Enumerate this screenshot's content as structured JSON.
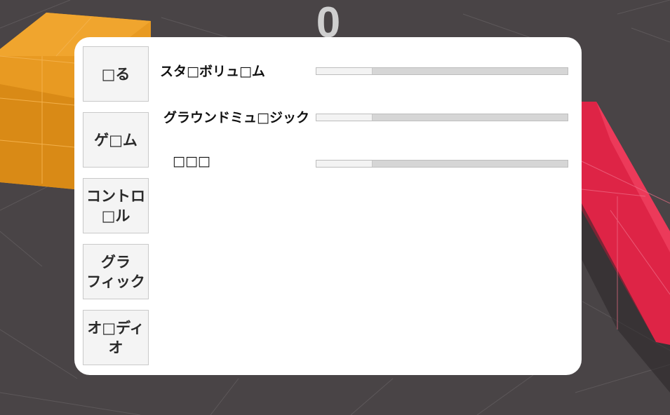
{
  "hud": {
    "score": "0"
  },
  "settings": {
    "tabs": [
      {
        "label": "□る",
        "icon": "back"
      },
      {
        "label": "ゲ□ム",
        "icon": "game"
      },
      {
        "label": "コントロ\n□ル",
        "icon": "controls"
      },
      {
        "label": "グラ\nフィック",
        "icon": "graphics"
      },
      {
        "label": "オ□ディ\nオ",
        "icon": "audio"
      }
    ],
    "audio": {
      "rows": [
        {
          "label": "スタ□ボリュ□ム",
          "value": 0.22
        },
        {
          "label": "グラウンドミュ□ジック",
          "value": 0.22
        },
        {
          "label": "□□□",
          "value": 0.22
        }
      ]
    }
  },
  "colors": {
    "ground": "#494446",
    "orange_block": "#e89a22",
    "red_block": "#de2446",
    "panel": "#ffffff"
  }
}
